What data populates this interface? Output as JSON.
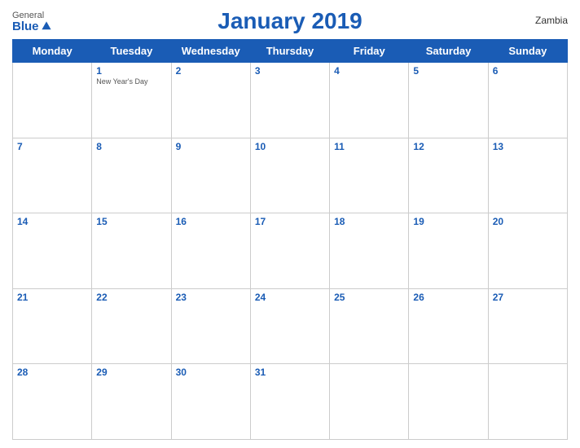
{
  "header": {
    "title": "January 2019",
    "country": "Zambia",
    "logo": {
      "general": "General",
      "blue": "Blue"
    }
  },
  "weekdays": [
    "Monday",
    "Tuesday",
    "Wednesday",
    "Thursday",
    "Friday",
    "Saturday",
    "Sunday"
  ],
  "weeks": [
    [
      {
        "day": "",
        "empty": true
      },
      {
        "day": "1",
        "holiday": "New Year's Day"
      },
      {
        "day": "2"
      },
      {
        "day": "3"
      },
      {
        "day": "4"
      },
      {
        "day": "5"
      },
      {
        "day": "6"
      }
    ],
    [
      {
        "day": "7"
      },
      {
        "day": "8"
      },
      {
        "day": "9"
      },
      {
        "day": "10"
      },
      {
        "day": "11"
      },
      {
        "day": "12"
      },
      {
        "day": "13"
      }
    ],
    [
      {
        "day": "14"
      },
      {
        "day": "15"
      },
      {
        "day": "16"
      },
      {
        "day": "17"
      },
      {
        "day": "18"
      },
      {
        "day": "19"
      },
      {
        "day": "20"
      }
    ],
    [
      {
        "day": "21"
      },
      {
        "day": "22"
      },
      {
        "day": "23"
      },
      {
        "day": "24"
      },
      {
        "day": "25"
      },
      {
        "day": "26"
      },
      {
        "day": "27"
      }
    ],
    [
      {
        "day": "28"
      },
      {
        "day": "29"
      },
      {
        "day": "30"
      },
      {
        "day": "31"
      },
      {
        "day": "",
        "empty": true
      },
      {
        "day": "",
        "empty": true
      },
      {
        "day": "",
        "empty": true
      }
    ]
  ]
}
